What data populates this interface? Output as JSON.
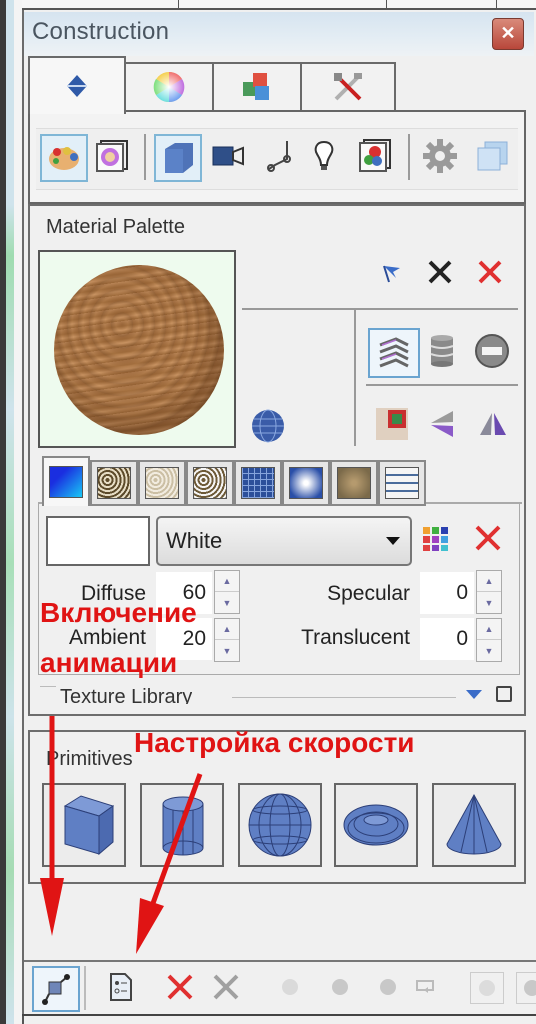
{
  "window": {
    "title": "Construction",
    "close_label": "✕"
  },
  "tabs": [
    {
      "name": "tab-construction",
      "icon": "up-down-arrows-icon",
      "active": true
    },
    {
      "name": "tab-color",
      "icon": "color-wheel-icon",
      "active": false
    },
    {
      "name": "tab-objects",
      "icon": "colored-cubes-icon",
      "active": false
    },
    {
      "name": "tab-tools",
      "icon": "tools-icon",
      "active": false
    }
  ],
  "toolbar": {
    "items": [
      {
        "name": "material-palette-button",
        "icon": "palette-icon",
        "selected": true
      },
      {
        "name": "color-window-button",
        "icon": "color-wheel-window-icon",
        "selected": false
      },
      {
        "name": "primitives-button",
        "icon": "cube-icon",
        "selected": true
      },
      {
        "name": "camera-button",
        "icon": "camera-icon",
        "selected": false
      },
      {
        "name": "joint-button",
        "icon": "joint-icon",
        "selected": false
      },
      {
        "name": "light-button",
        "icon": "light-bulb-icon",
        "selected": false
      },
      {
        "name": "scene-button",
        "icon": "scene-window-icon",
        "selected": false
      },
      {
        "name": "settings-button",
        "icon": "gear-icon",
        "selected": false
      },
      {
        "name": "windows-button",
        "icon": "stacked-windows-icon",
        "selected": false
      }
    ]
  },
  "material_palette": {
    "title": "Material Palette",
    "actions": [
      {
        "name": "flag-button",
        "icon": "flag-icon"
      },
      {
        "name": "delete-button",
        "icon": "x-icon"
      },
      {
        "name": "remove-button",
        "icon": "red-x-icon"
      }
    ],
    "preview_shapes": [
      {
        "name": "layers-button",
        "icon": "layers-icon",
        "selected": true
      },
      {
        "name": "cylinder-stack-button",
        "icon": "database-icon",
        "selected": false
      },
      {
        "name": "ball-button",
        "icon": "ball-icon",
        "selected": false
      },
      {
        "name": "texture-map-button",
        "icon": "texture-map-icon",
        "selected": false
      },
      {
        "name": "flip-horizontal-button",
        "icon": "flip-horizontal-icon",
        "selected": false
      },
      {
        "name": "flip-vertical-button",
        "icon": "flip-vertical-icon",
        "selected": false
      }
    ],
    "sphere_button_icon": "globe-icon",
    "channel_tabs": [
      {
        "name": "color-channel-tab",
        "icon": "blue-gradient-swatch",
        "colors": [
          "#1a2ee0",
          "#19c8f5"
        ],
        "active": true
      },
      {
        "name": "bump-channel-tab",
        "icon": "bump-texture-swatch",
        "colors": [
          "#5c4a2a",
          "#e6dcc4"
        ],
        "active": false
      },
      {
        "name": "specular-channel-tab",
        "icon": "light-texture-swatch",
        "colors": [
          "#cbbfa4",
          "#f2ece0"
        ],
        "active": false
      },
      {
        "name": "transparency-channel-tab",
        "icon": "fade-texture-swatch",
        "colors": [
          "#6d5a38",
          "#f5f5f5"
        ],
        "active": false
      },
      {
        "name": "grid-channel-tab",
        "icon": "grid-swatch",
        "colors": [
          "#2c4f9a",
          "#86a4dc"
        ],
        "active": false
      },
      {
        "name": "glow-channel-tab",
        "icon": "glow-swatch",
        "colors": [
          "#ffffff",
          "#2a4fa8"
        ],
        "active": false
      },
      {
        "name": "reflection-channel-tab",
        "icon": "reflection-swatch",
        "colors": [
          "#b59a6e",
          "#7b6a4a"
        ],
        "active": false
      },
      {
        "name": "properties-channel-tab",
        "icon": "list-icon",
        "colors": [
          "#f5f5f5",
          "#4a6c9c"
        ],
        "active": false
      }
    ],
    "color_name": "White",
    "color_swatch": "#ffffff",
    "fields": {
      "diffuse": {
        "label": "Diffuse",
        "value": "60"
      },
      "ambient": {
        "label": "Ambient",
        "value": "20"
      },
      "specular": {
        "label": "Specular",
        "value": "0"
      },
      "translucent": {
        "label": "Translucent",
        "value": "0"
      }
    },
    "texture_library_label": "Texture Library"
  },
  "primitives": {
    "title": "Primitives",
    "items": [
      {
        "name": "cube-primitive",
        "icon": "cube-icon"
      },
      {
        "name": "cylinder-primitive",
        "icon": "cylinder-icon"
      },
      {
        "name": "sphere-primitive",
        "icon": "sphere-icon"
      },
      {
        "name": "torus-primitive",
        "icon": "torus-icon"
      },
      {
        "name": "cone-primitive",
        "icon": "cone-icon"
      }
    ]
  },
  "annotations": {
    "enable_animation": [
      "Включение",
      "анимации"
    ],
    "speed_setting": "Настройка скорости"
  },
  "bottom_toolbar": {
    "items": [
      {
        "name": "animation-path-button",
        "icon": "path-nodes-icon",
        "selected": true
      },
      {
        "name": "animation-settings-button",
        "icon": "document-settings-icon"
      },
      {
        "name": "delete-red-button",
        "icon": "red-x-icon"
      },
      {
        "name": "delete-gray-button",
        "icon": "gray-x-icon"
      },
      {
        "name": "keyframe-1-button",
        "icon": "dot-icon"
      },
      {
        "name": "keyframe-2-button",
        "icon": "dot-icon"
      },
      {
        "name": "keyframe-3-button",
        "icon": "dot-icon"
      },
      {
        "name": "loop-button",
        "icon": "loop-icon"
      },
      {
        "name": "record-button",
        "icon": "dot-box-icon"
      },
      {
        "name": "play-button",
        "icon": "dot-box-icon"
      }
    ]
  },
  "colors": {
    "annotation_red": "#e01414",
    "primitive_blue": "#5a7cc0",
    "selection_blue": "#7fb6d6",
    "close_red": "#b8473a"
  }
}
